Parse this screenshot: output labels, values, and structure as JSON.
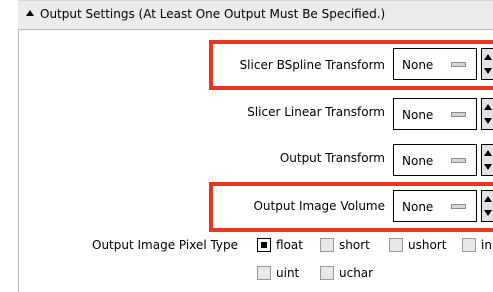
{
  "panel": {
    "title": "Output Settings (At Least One Output Must Be Specified.)",
    "collapse_icon": "triangle-up-icon"
  },
  "fields": [
    {
      "label": "Slicer BSpline Transform",
      "value": "None",
      "highlighted": true
    },
    {
      "label": "Slicer Linear Transform",
      "value": "None",
      "highlighted": false
    },
    {
      "label": "Output Transform",
      "value": "None",
      "highlighted": false
    },
    {
      "label": "Output Image Volume",
      "value": "None",
      "highlighted": true
    }
  ],
  "pixel_type": {
    "label": "Output Image Pixel Type",
    "options": [
      {
        "label": "float",
        "checked": true
      },
      {
        "label": "short",
        "checked": false
      },
      {
        "label": "ushort",
        "checked": false
      },
      {
        "label": "in",
        "checked": false
      },
      {
        "label": "uint",
        "checked": false
      },
      {
        "label": "uchar",
        "checked": false
      }
    ]
  },
  "colors": {
    "highlight": "#e8371e",
    "header_bg": "#ececec"
  }
}
